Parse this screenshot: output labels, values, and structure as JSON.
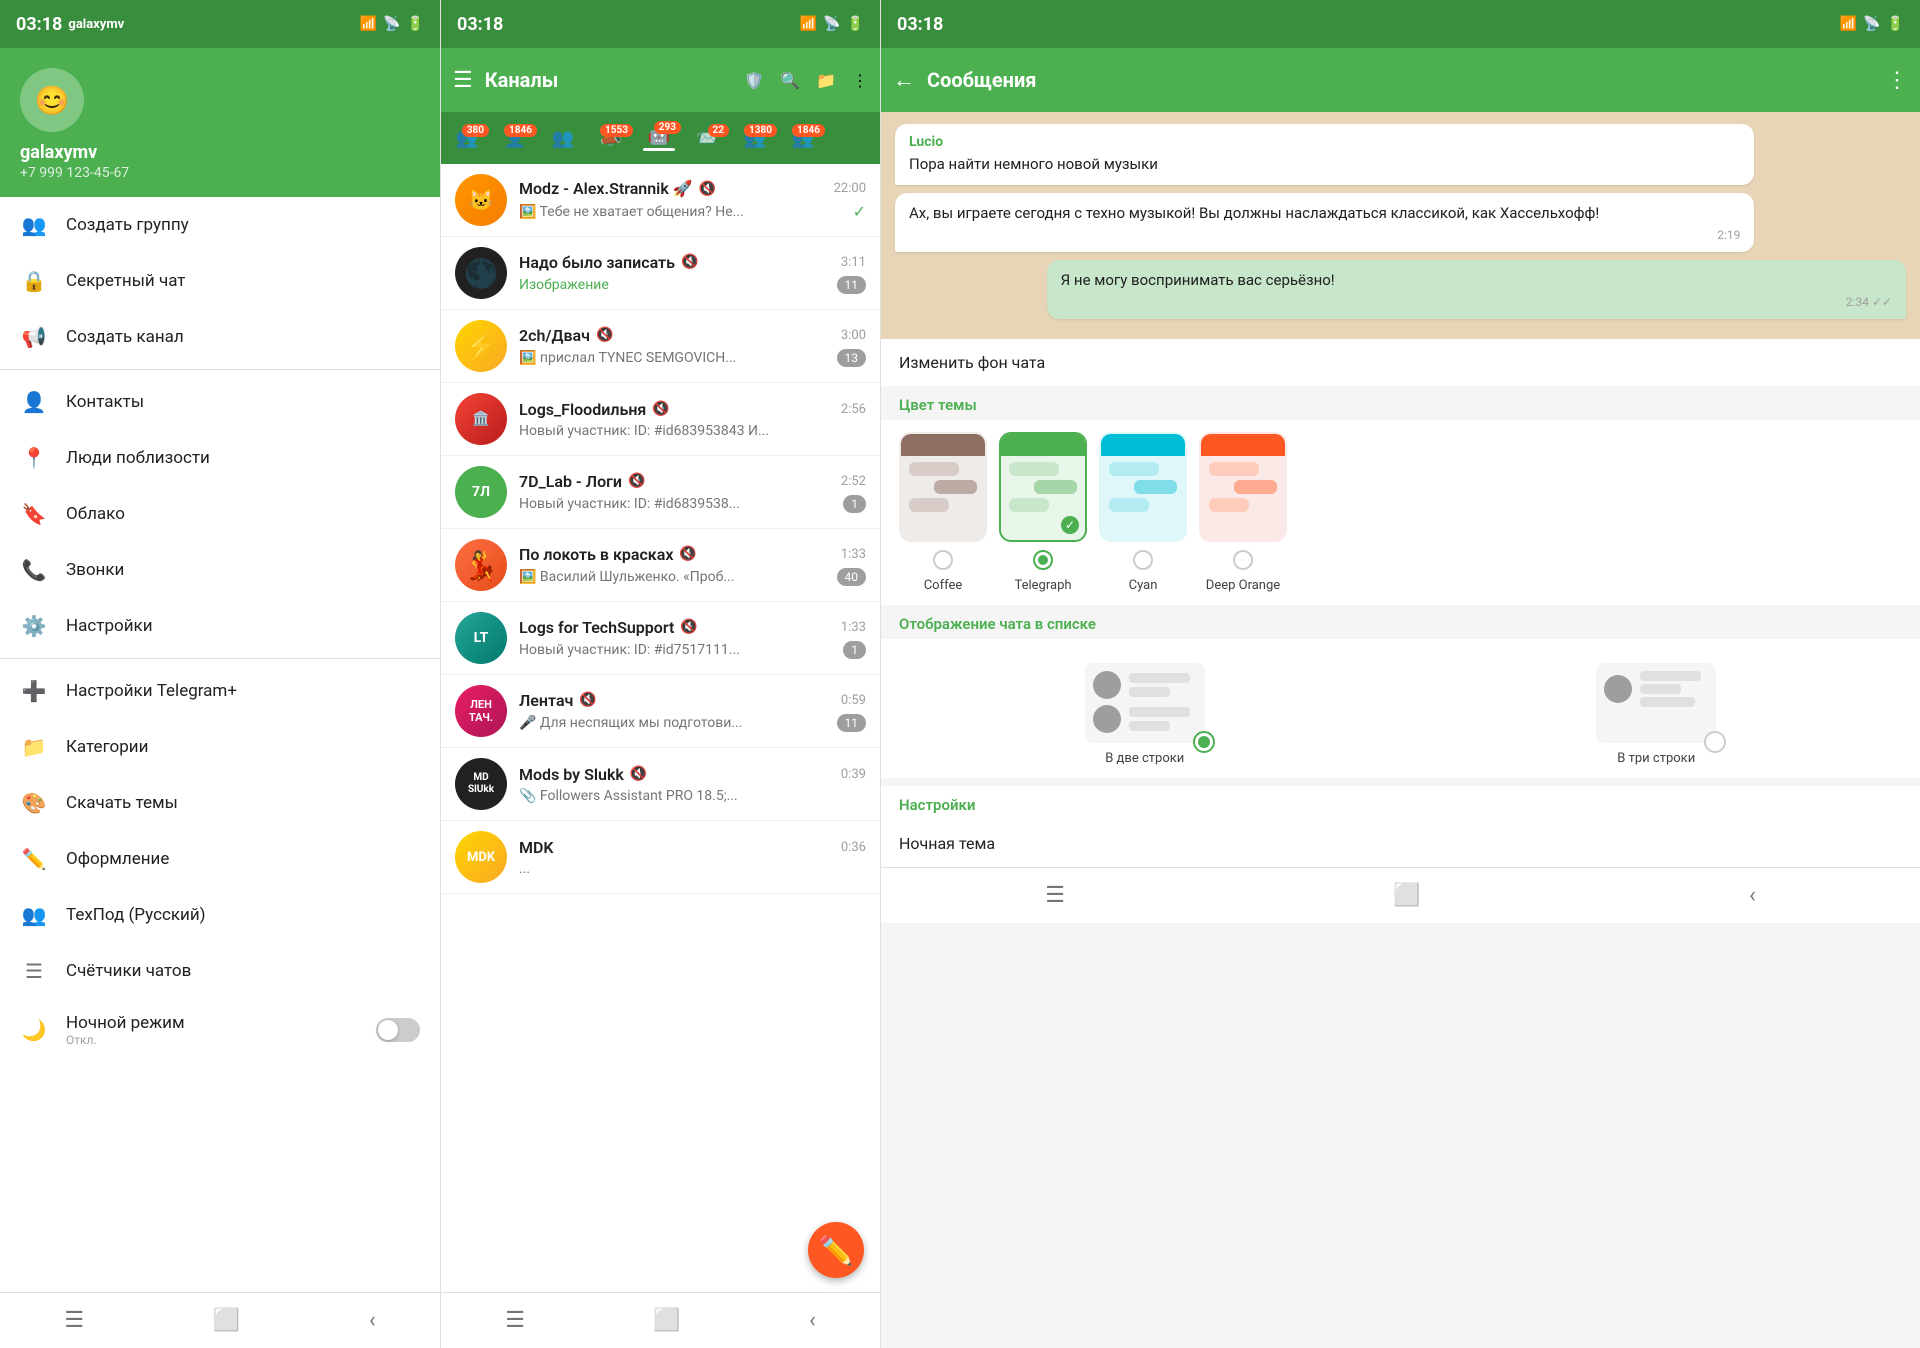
{
  "statusBar": {
    "time": "03:18",
    "deviceName": "galaxymv"
  },
  "panel1": {
    "header": {
      "avatarLetter": "😊",
      "username": "galaxymv",
      "phone": "+7 999 123-45-67"
    },
    "menuItems": [
      {
        "id": "create-group",
        "icon": "👥",
        "label": "Создать группу"
      },
      {
        "id": "secret-chat",
        "icon": "🔒",
        "label": "Секретный чат"
      },
      {
        "id": "create-channel",
        "icon": "📢",
        "label": "Создать канал"
      },
      {
        "id": "divider1",
        "type": "divider"
      },
      {
        "id": "contacts",
        "icon": "👤",
        "label": "Контакты"
      },
      {
        "id": "nearby",
        "icon": "📍",
        "label": "Люди поблизости"
      },
      {
        "id": "cloud",
        "icon": "🔖",
        "label": "Облако"
      },
      {
        "id": "calls",
        "icon": "📞",
        "label": "Звонки"
      },
      {
        "id": "settings",
        "icon": "⚙️",
        "label": "Настройки"
      },
      {
        "id": "divider2",
        "type": "divider"
      },
      {
        "id": "tgplus",
        "icon": "➕",
        "label": "Настройки Telegram+"
      },
      {
        "id": "categories",
        "icon": "📁",
        "label": "Категории"
      },
      {
        "id": "themes",
        "icon": "🎨",
        "label": "Скачать темы"
      },
      {
        "id": "design",
        "icon": "✏️",
        "label": "Оформление"
      },
      {
        "id": "techsup",
        "icon": "👥",
        "label": "ТехПод (Русский)"
      },
      {
        "id": "counters",
        "icon": "☰",
        "label": "Счётчики чатов"
      },
      {
        "id": "nightmode",
        "icon": "🌙",
        "label": "Ночной режим",
        "subtitle": "Откл.",
        "toggle": true
      }
    ]
  },
  "panel2": {
    "topbar": {
      "title": "Каналы",
      "menuIcon": "☰",
      "shieldIcon": "🛡️",
      "searchIcon": "🔍",
      "folderIcon": "📁",
      "moreIcon": "⋮"
    },
    "tabs": [
      {
        "id": "t1",
        "icon": "👥",
        "badge": "380",
        "active": false
      },
      {
        "id": "t2",
        "icon": "👤",
        "badge": "1846",
        "active": false
      },
      {
        "id": "t3",
        "icon": "👥",
        "badge": "",
        "active": false
      },
      {
        "id": "t4",
        "icon": "📣",
        "badge": "1553",
        "active": false
      },
      {
        "id": "t5",
        "icon": "🤖",
        "badge": "293",
        "active": true
      },
      {
        "id": "t6",
        "icon": "📨",
        "badge": "22",
        "active": false
      },
      {
        "id": "t7",
        "icon": "👥",
        "badge": "1380",
        "active": false
      },
      {
        "id": "t8",
        "icon": "👥",
        "badge": "1846",
        "active": false
      }
    ],
    "chats": [
      {
        "id": "c1",
        "avatarColor": "av-orange",
        "avatarText": "🐱",
        "name": "Modz - Alex.Strannik 🚀",
        "muted": true,
        "time": "22:00",
        "preview": "🖼️ Тебе не хватает общения? Не...",
        "unread": "",
        "sentIcon": "✓"
      },
      {
        "id": "c2",
        "avatarColor": "av-dark",
        "avatarText": "🌑",
        "name": "Надо было записать",
        "muted": true,
        "time": "3:11",
        "preview": "Изображение",
        "previewColor": "#4caf50",
        "unread": "11",
        "unreadColor": "gray"
      },
      {
        "id": "c3",
        "avatarColor": "av-yellow",
        "avatarText": "⚡",
        "name": "2ch/Двач",
        "muted": true,
        "time": "3:00",
        "preview": "🖼️ прислал TYNEC SEMGOVICH...",
        "unread": "13",
        "unreadColor": "gray"
      },
      {
        "id": "c4",
        "avatarColor": "av-red",
        "avatarText": "🏛️",
        "name": "Logs_Floodильня",
        "muted": true,
        "time": "2:56",
        "preview": "Новый участник: ID: #id683953843 И...",
        "unread": "",
        "unreadColor": ""
      },
      {
        "id": "c5",
        "avatarColor": "av-green",
        "avatarText": "7Л",
        "name": "7D_Lab - Логи",
        "muted": true,
        "time": "2:52",
        "preview": "Новый участник: ID: #id6839538...",
        "unread": "1",
        "unreadColor": "gray"
      },
      {
        "id": "c6",
        "avatarColor": "av-orange2",
        "avatarText": "💃",
        "name": "По локоть в красках",
        "muted": true,
        "time": "1:33",
        "preview": "🖼️ Василий Шульженко. «Проб...",
        "unread": "40",
        "unreadColor": "gray"
      },
      {
        "id": "c7",
        "avatarColor": "av-teal",
        "avatarText": "LT",
        "name": "Logs for TechSupport",
        "muted": true,
        "time": "1:33",
        "preview": "Новый участник: ID: #id7517111...",
        "unread": "1",
        "unreadColor": "gray"
      },
      {
        "id": "c8",
        "avatarColor": "av-pink",
        "avatarText": "ЛЕН ТАЧ.",
        "name": "Лентач",
        "muted": true,
        "time": "0:59",
        "preview": "🎤 Для неспящих мы подготови...",
        "unread": "11",
        "unreadColor": "gray"
      },
      {
        "id": "c9",
        "avatarColor": "av-dark",
        "avatarText": "MD SlUkk",
        "name": "Mods by Slukk",
        "muted": true,
        "time": "0:39",
        "preview": "📎 Followers Assistant PRO 18.5;...",
        "unread": "",
        "fabVisible": true
      },
      {
        "id": "c10",
        "avatarColor": "av-yellow",
        "avatarText": "MDK",
        "name": "MDK",
        "muted": false,
        "time": "0:36",
        "preview": "...",
        "unread": ""
      }
    ]
  },
  "panel3": {
    "topbar": {
      "backIcon": "←",
      "title": "Сообщения",
      "moreIcon": "⋮"
    },
    "messages": [
      {
        "id": "m1",
        "type": "other",
        "sender": "Lucio",
        "text": "Пора найти немного новой музыки",
        "time": ""
      },
      {
        "id": "m2",
        "type": "other",
        "sender": "",
        "text": "Ах, вы играете сегодня с техно музыкой! Вы должны наслаждаться классикой, как Хассельхофф!",
        "time": "2:19"
      },
      {
        "id": "m3",
        "type": "mine",
        "sender": "",
        "text": "Я не могу воспринимать вас серьёзно!",
        "time": "2:34"
      }
    ],
    "changeBgLabel": "Изменить фон чата",
    "colorThemeLabel": "Цвет темы",
    "themes": [
      {
        "id": "coffee",
        "label": "Coffee",
        "selected": false,
        "headerColor": "#8d6e63",
        "bgColor": "#efebe9",
        "bubbleColor": "#d7ccc8",
        "bubbleMineColor": "#bcaaa4"
      },
      {
        "id": "telegraph",
        "label": "Telegraph",
        "selected": true,
        "headerColor": "#4caf50",
        "bgColor": "#e8f5e9",
        "bubbleColor": "#c8e6c9",
        "bubbleMineColor": "#a5d6a7"
      },
      {
        "id": "cyan",
        "label": "Cyan",
        "selected": false,
        "headerColor": "#00bcd4",
        "bgColor": "#e0f7fa",
        "bubbleColor": "#b2ebf2",
        "bubbleMineColor": "#80deea"
      },
      {
        "id": "deeporange",
        "label": "Deep Orange",
        "selected": false,
        "headerColor": "#ff5722",
        "bgColor": "#fbe9e7",
        "bubbleColor": "#ffccbc",
        "bubbleMineColor": "#ffab91"
      }
    ],
    "displayLabel": "Отображение чата в списке",
    "displayOptions": [
      {
        "id": "two-lines",
        "label": "В две строки",
        "selected": true
      },
      {
        "id": "three-lines",
        "label": "В три строки",
        "selected": false
      }
    ],
    "settingsLabel": "Настройки",
    "nightThemeLabel": "Ночная тема"
  }
}
